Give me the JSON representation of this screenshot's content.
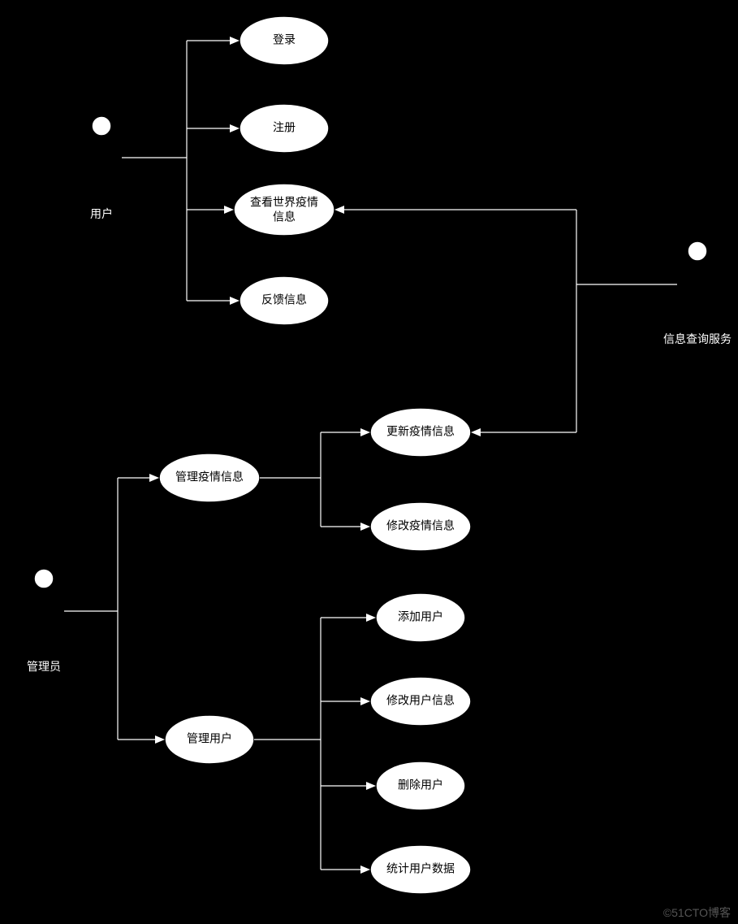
{
  "actors": {
    "user": "用户",
    "admin": "管理员",
    "infoservice": "信息查询服务"
  },
  "usecases": {
    "login": "登录",
    "register": "注册",
    "view_world_l1": "查看世界疫情",
    "view_world_l2": "信息",
    "feedback": "反馈信息",
    "update_epidemic": "更新疫情信息",
    "manage_epidemic": "管理疫情信息",
    "modify_epidemic": "修改疫情信息",
    "add_user": "添加用户",
    "modify_user": "修改用户信息",
    "manage_user": "管理用户",
    "delete_user": "删除用户",
    "stats_user": "统计用户数据"
  },
  "watermark": "©51CTO博客"
}
